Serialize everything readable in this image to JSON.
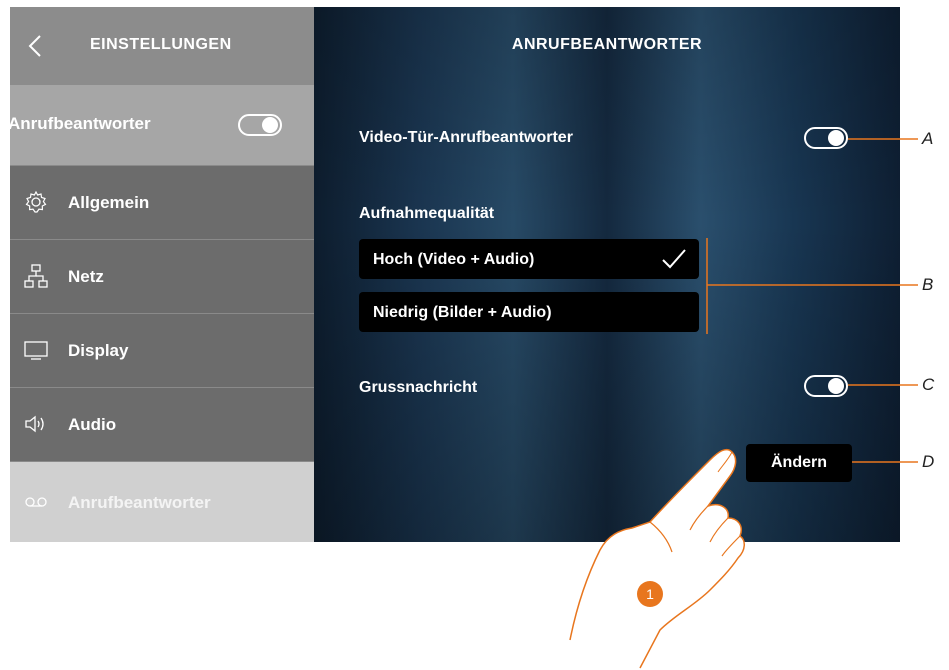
{
  "sidebar": {
    "title": "EINSTELLUNGEN",
    "toggle_label": "Anrufbeantworter",
    "items": [
      {
        "label": "Allgemein",
        "icon": "gear-icon"
      },
      {
        "label": "Netz",
        "icon": "network-icon"
      },
      {
        "label": "Display",
        "icon": "display-icon"
      },
      {
        "label": "Audio",
        "icon": "speaker-icon"
      },
      {
        "label": "Anrufbeantworter",
        "icon": "voicemail-icon"
      }
    ]
  },
  "main": {
    "title": "ANRUFBEANTWORTER",
    "video_answering_label": "Video-Tür-Anrufbeantworter",
    "quality_label": "Aufnahmequalität",
    "options": [
      {
        "label": "Hoch (Video + Audio)",
        "selected": true
      },
      {
        "label": "Niedrig (Bilder + Audio)",
        "selected": false
      }
    ],
    "greeting_label": "Grussnachricht",
    "change_button": "Ändern"
  },
  "callouts": {
    "a": "A",
    "b": "B",
    "c": "C",
    "d": "D",
    "step": "1"
  },
  "colors": {
    "accent": "#e8761e",
    "sidebar": "#6c6c6c",
    "active_item": "#d0d0d0"
  }
}
